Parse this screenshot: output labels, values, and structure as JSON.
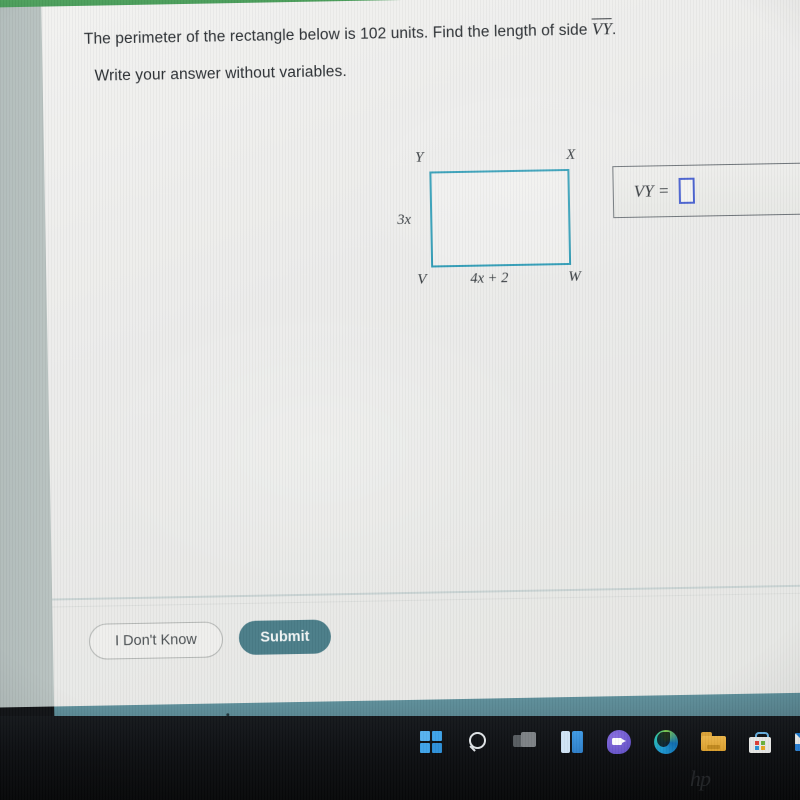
{
  "question": {
    "line1_pre": "The perimeter of the rectangle below is 102 units. Find the length of side ",
    "line1_var": "VY",
    "line1_post": ".",
    "line2": "Write your answer without variables."
  },
  "figure": {
    "vertex_top_left": "Y",
    "vertex_top_right": "X",
    "vertex_bottom_left": "V",
    "vertex_bottom_right": "W",
    "left_side_label": "3x",
    "bottom_side_label": "4x + 2",
    "stroke_color": "#2f9cb6"
  },
  "answer": {
    "prefix": "VY =",
    "value": "",
    "input_border_color": "#4a62d0"
  },
  "footer": {
    "dont_know_label": "I Don't Know",
    "submit_label": "Submit",
    "submit_color": "#4b7d89"
  },
  "taskbar": {
    "icons": [
      {
        "name": "start-icon",
        "label": "Start"
      },
      {
        "name": "search-icon",
        "label": "Search"
      },
      {
        "name": "task-view-icon",
        "label": "Task View"
      },
      {
        "name": "widgets-icon",
        "label": "Widgets"
      },
      {
        "name": "teams-chat-icon",
        "label": "Chat"
      },
      {
        "name": "edge-browser-icon",
        "label": "Microsoft Edge"
      },
      {
        "name": "file-explorer-icon",
        "label": "File Explorer"
      },
      {
        "name": "microsoft-store-icon",
        "label": "Microsoft Store"
      },
      {
        "name": "mail-icon",
        "label": "Mail"
      }
    ],
    "brand_mark": "hp"
  },
  "chrome": {
    "top_bar_color": "#4da05c",
    "footer_band_color": "#567f8a"
  }
}
